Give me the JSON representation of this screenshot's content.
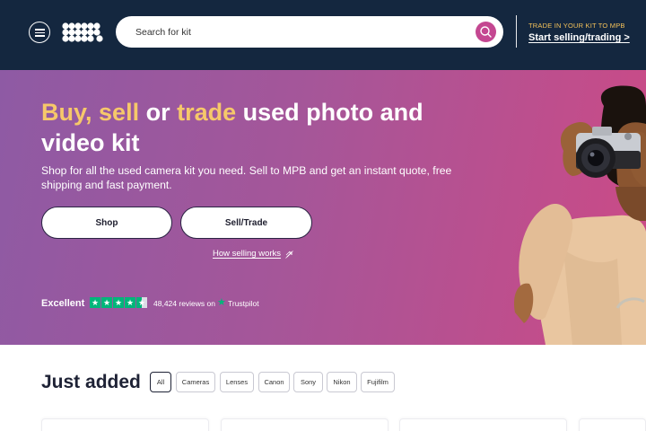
{
  "header": {
    "search_placeholder": "Search for kit",
    "trade_eyebrow": "TRADE IN YOUR KIT TO MPB",
    "trade_link": "Start selling/trading >"
  },
  "hero": {
    "title": {
      "w1": "Buy,",
      "w2": "sell",
      "w3": "or",
      "w4": "trade",
      "rest": "used photo and video kit"
    },
    "subtitle": "Shop for all the used camera kit you need. Sell to MPB and get an instant quote, free shipping and fast payment.",
    "shop_label": "Shop",
    "sell_label": "Sell/Trade",
    "how_link": "How selling works",
    "trustpilot": {
      "rating_text": "Excellent",
      "stars": 4.5,
      "reviews": "48,424 reviews on",
      "brand": "Trustpilot"
    }
  },
  "just_added": {
    "heading": "Just added",
    "filters": [
      "All",
      "Cameras",
      "Lenses",
      "Canon",
      "Sony",
      "Nikon",
      "Fujifilm"
    ],
    "active_filter": "All"
  },
  "colors": {
    "header_bg": "#14273f",
    "accent_yellow": "#f6c86a",
    "search_button": "#c44791",
    "trustpilot_green": "#00b67a"
  },
  "icons": [
    "menu-icon",
    "mpb-logo",
    "search-icon",
    "external-link-icon",
    "star-icon",
    "trustpilot-star-icon"
  ]
}
